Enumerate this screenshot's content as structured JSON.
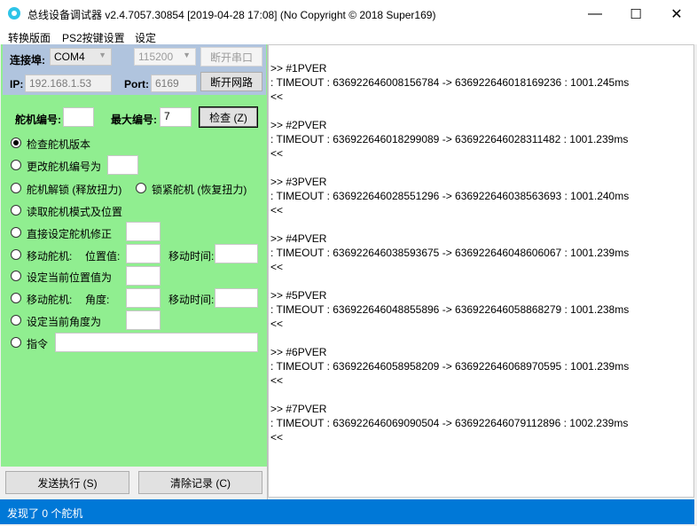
{
  "window": {
    "title": "总线设备调试器 v2.4.7057.30854  [2019-04-28 17:08]  (No Copyright © 2018 Super169)",
    "controls": {
      "minimize": "—",
      "maximize": "☐",
      "close": "✕"
    }
  },
  "menu": [
    "转换版面",
    "PS2按键设置",
    "设定"
  ],
  "connection": {
    "port_label": "连接埠:",
    "port_value": "COM4",
    "baud_value": "115200",
    "disconnect_serial": "断开串口",
    "ip_label": "IP:",
    "ip_value": "192.168.1.53",
    "portnum_label": "Port:",
    "portnum_value": "6169",
    "disconnect_network": "断开网路"
  },
  "servo": {
    "id_label": "舵机编号:",
    "id_value": "",
    "max_label": "最大编号:",
    "max_value": "7",
    "check_button": "检查 (Z)"
  },
  "options": {
    "check_version": "检查舵机版本",
    "change_id": "更改舵机编号为",
    "unlock": "舵机解锁 (释放扭力)",
    "lock": "锁紧舵机 (恢复扭力)",
    "read_mode": "读取舵机模式及位置",
    "set_correction": "直接设定舵机修正",
    "move_pos": "移动舵机:",
    "pos_label": "位置值:",
    "move_time_label": "移动时间:",
    "set_current_pos": "设定当前位置值为",
    "move_angle": "移动舵机:",
    "angle_label": "角度:",
    "move_time_label2": "移动时间:",
    "set_current_angle": "设定当前角度为",
    "command": "指令",
    "selected": "check_version"
  },
  "actions": {
    "send": "发送执行 (S)",
    "clear": "清除记录 (C)"
  },
  "log": [
    {
      "header": ">> #1PVER",
      "timeout": ": TIMEOUT : 636922646008156784 -> 636922646018169236 : 1001.245ms",
      "end": "<<"
    },
    {
      "header": ">> #2PVER",
      "timeout": ": TIMEOUT : 636922646018299089 -> 636922646028311482 : 1001.239ms",
      "end": "<<"
    },
    {
      "header": ">> #3PVER",
      "timeout": ": TIMEOUT : 636922646028551296 -> 636922646038563693 : 1001.240ms",
      "end": "<<"
    },
    {
      "header": ">> #4PVER",
      "timeout": ": TIMEOUT : 636922646038593675 -> 636922646048606067 : 1001.239ms",
      "end": "<<"
    },
    {
      "header": ">> #5PVER",
      "timeout": ": TIMEOUT : 636922646048855896 -> 636922646058868279 : 1001.238ms",
      "end": "<<"
    },
    {
      "header": ">> #6PVER",
      "timeout": ": TIMEOUT : 636922646058958209 -> 636922646068970595 : 1001.239ms",
      "end": "<<"
    },
    {
      "header": ">> #7PVER",
      "timeout": ": TIMEOUT : 636922646069090504 -> 636922646079112896 : 1002.239ms",
      "end": "<<"
    }
  ],
  "status": "发现了 0 个舵机",
  "colors": {
    "panel_green": "#90ee90",
    "panel_blue": "#b0c4de",
    "status_blue": "#0078d7"
  }
}
